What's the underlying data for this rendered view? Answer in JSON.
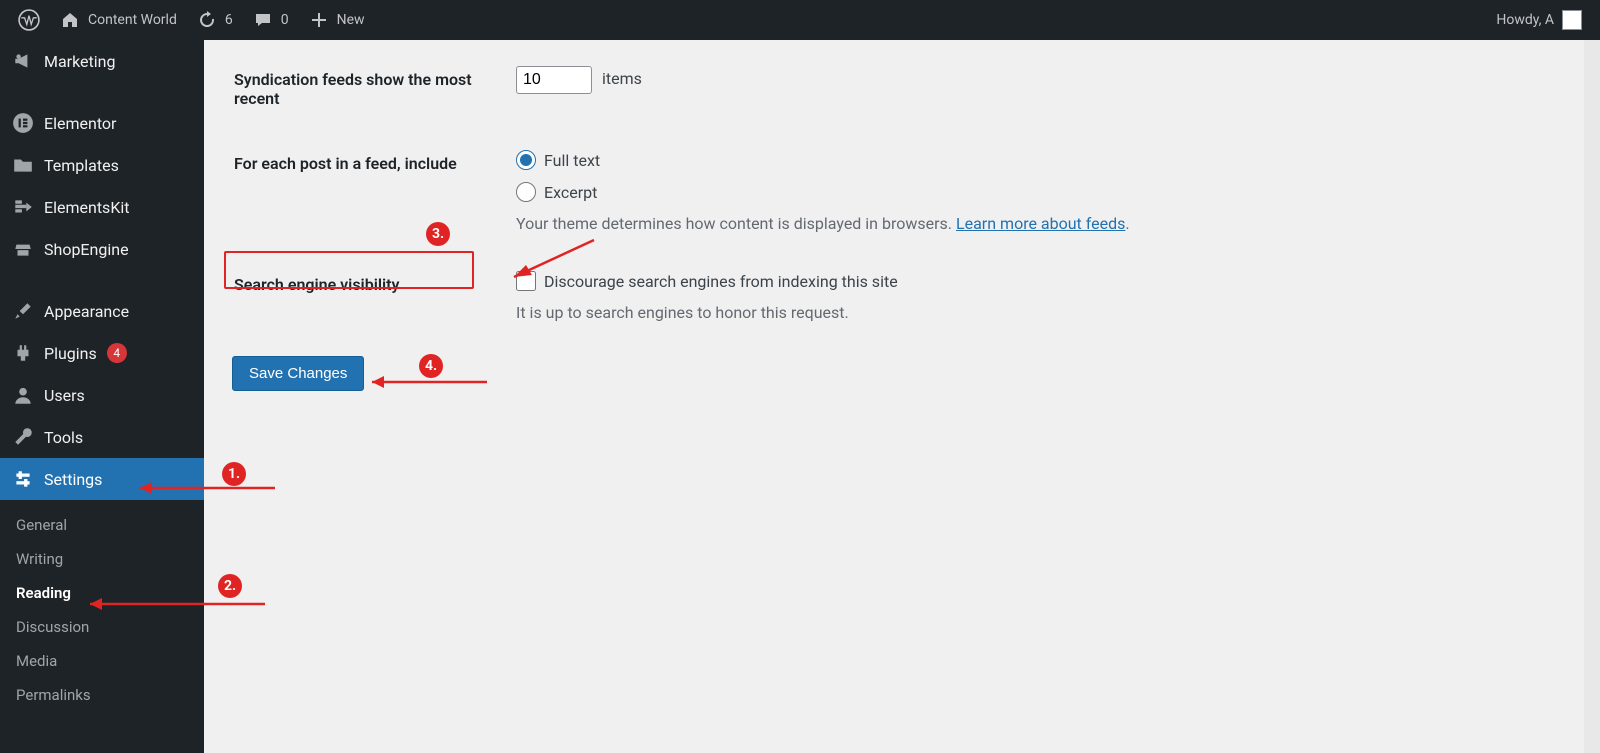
{
  "adminbar": {
    "site_name": "Content World",
    "updates": "6",
    "comments": "0",
    "new_label": "New",
    "howdy": "Howdy, A"
  },
  "sidebar": {
    "items": [
      {
        "label": "Marketing"
      },
      {
        "label": "Elementor"
      },
      {
        "label": "Templates"
      },
      {
        "label": "ElementsKit"
      },
      {
        "label": "ShopEngine"
      },
      {
        "label": "Appearance"
      },
      {
        "label": "Plugins"
      },
      {
        "label": "Users"
      },
      {
        "label": "Tools"
      },
      {
        "label": "Settings"
      }
    ],
    "plugins_badge": "4",
    "settings_sub": [
      "General",
      "Writing",
      "Reading",
      "Discussion",
      "Media",
      "Permalinks"
    ],
    "settings_active_sub": "Reading"
  },
  "settings": {
    "feed_row_label": "Syndication feeds show the most recent",
    "feed_value": "10",
    "feed_units": "items",
    "feed_include_label": "For each post in a feed, include",
    "feed_include_full": "Full text",
    "feed_include_excerpt": "Excerpt",
    "feed_include_desc1": "Your theme determines how content is displayed in browsers. ",
    "feed_include_link": "Learn more about feeds",
    "search_vis_label": "Search engine visibility",
    "search_vis_checkbox": "Discourage search engines from indexing this site",
    "search_vis_note": "It is up to search engines to honor this request.",
    "save_button": "Save Changes"
  },
  "annotations": {
    "n1": "1.",
    "n2": "2.",
    "n3": "3.",
    "n4": "4."
  }
}
